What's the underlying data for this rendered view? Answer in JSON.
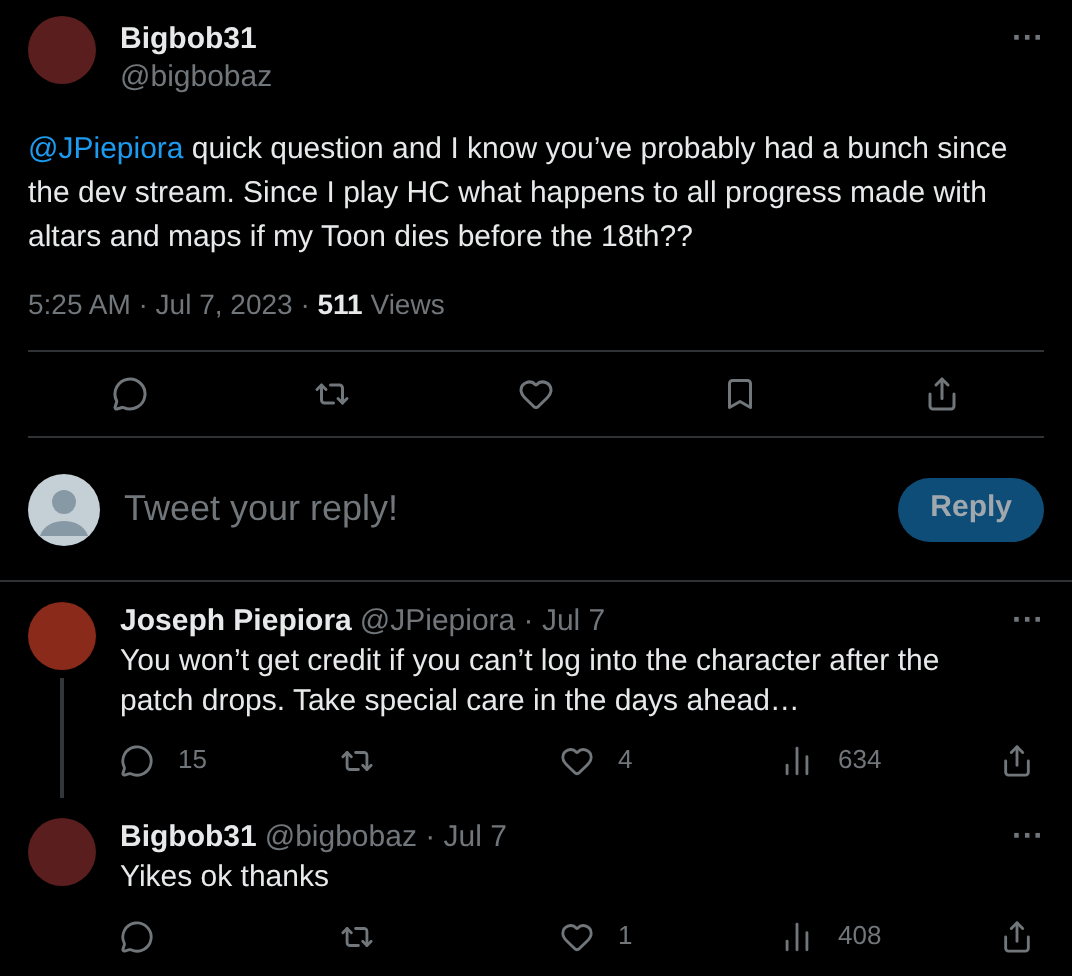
{
  "tweet": {
    "name": "Bigbob31",
    "handle": "@bigbobaz",
    "more": "···",
    "text": "@JPiepiora",
    "body": " quick question and I know you’ve probably had a bunch since the dev stream. Since I play HC what happens to all progress made with altars and maps if my Toon dies before the 18th??",
    "time": "5:25 AM · Jul 7, 2023 · ",
    "views_count": "511",
    "views_label": " Views"
  },
  "reply_box": {
    "placeholder": "Tweet your reply!",
    "button": "Reply",
    "disabled": true
  },
  "replies": [
    {
      "name": "Joseph Piepiora",
      "meta": "@JPiepiora · Jul 7",
      "more": "···",
      "text": "You won’t get credit if you can’t log into the character after the patch drops. Take special care in the days ahead…",
      "replies": "15",
      "likes": "4",
      "views": "634"
    },
    {
      "name": "Bigbob31",
      "meta": "@bigbobaz · Jul 7",
      "more": "···",
      "text": "Yikes ok thanks",
      "likes": "1",
      "views": "408"
    }
  ]
}
